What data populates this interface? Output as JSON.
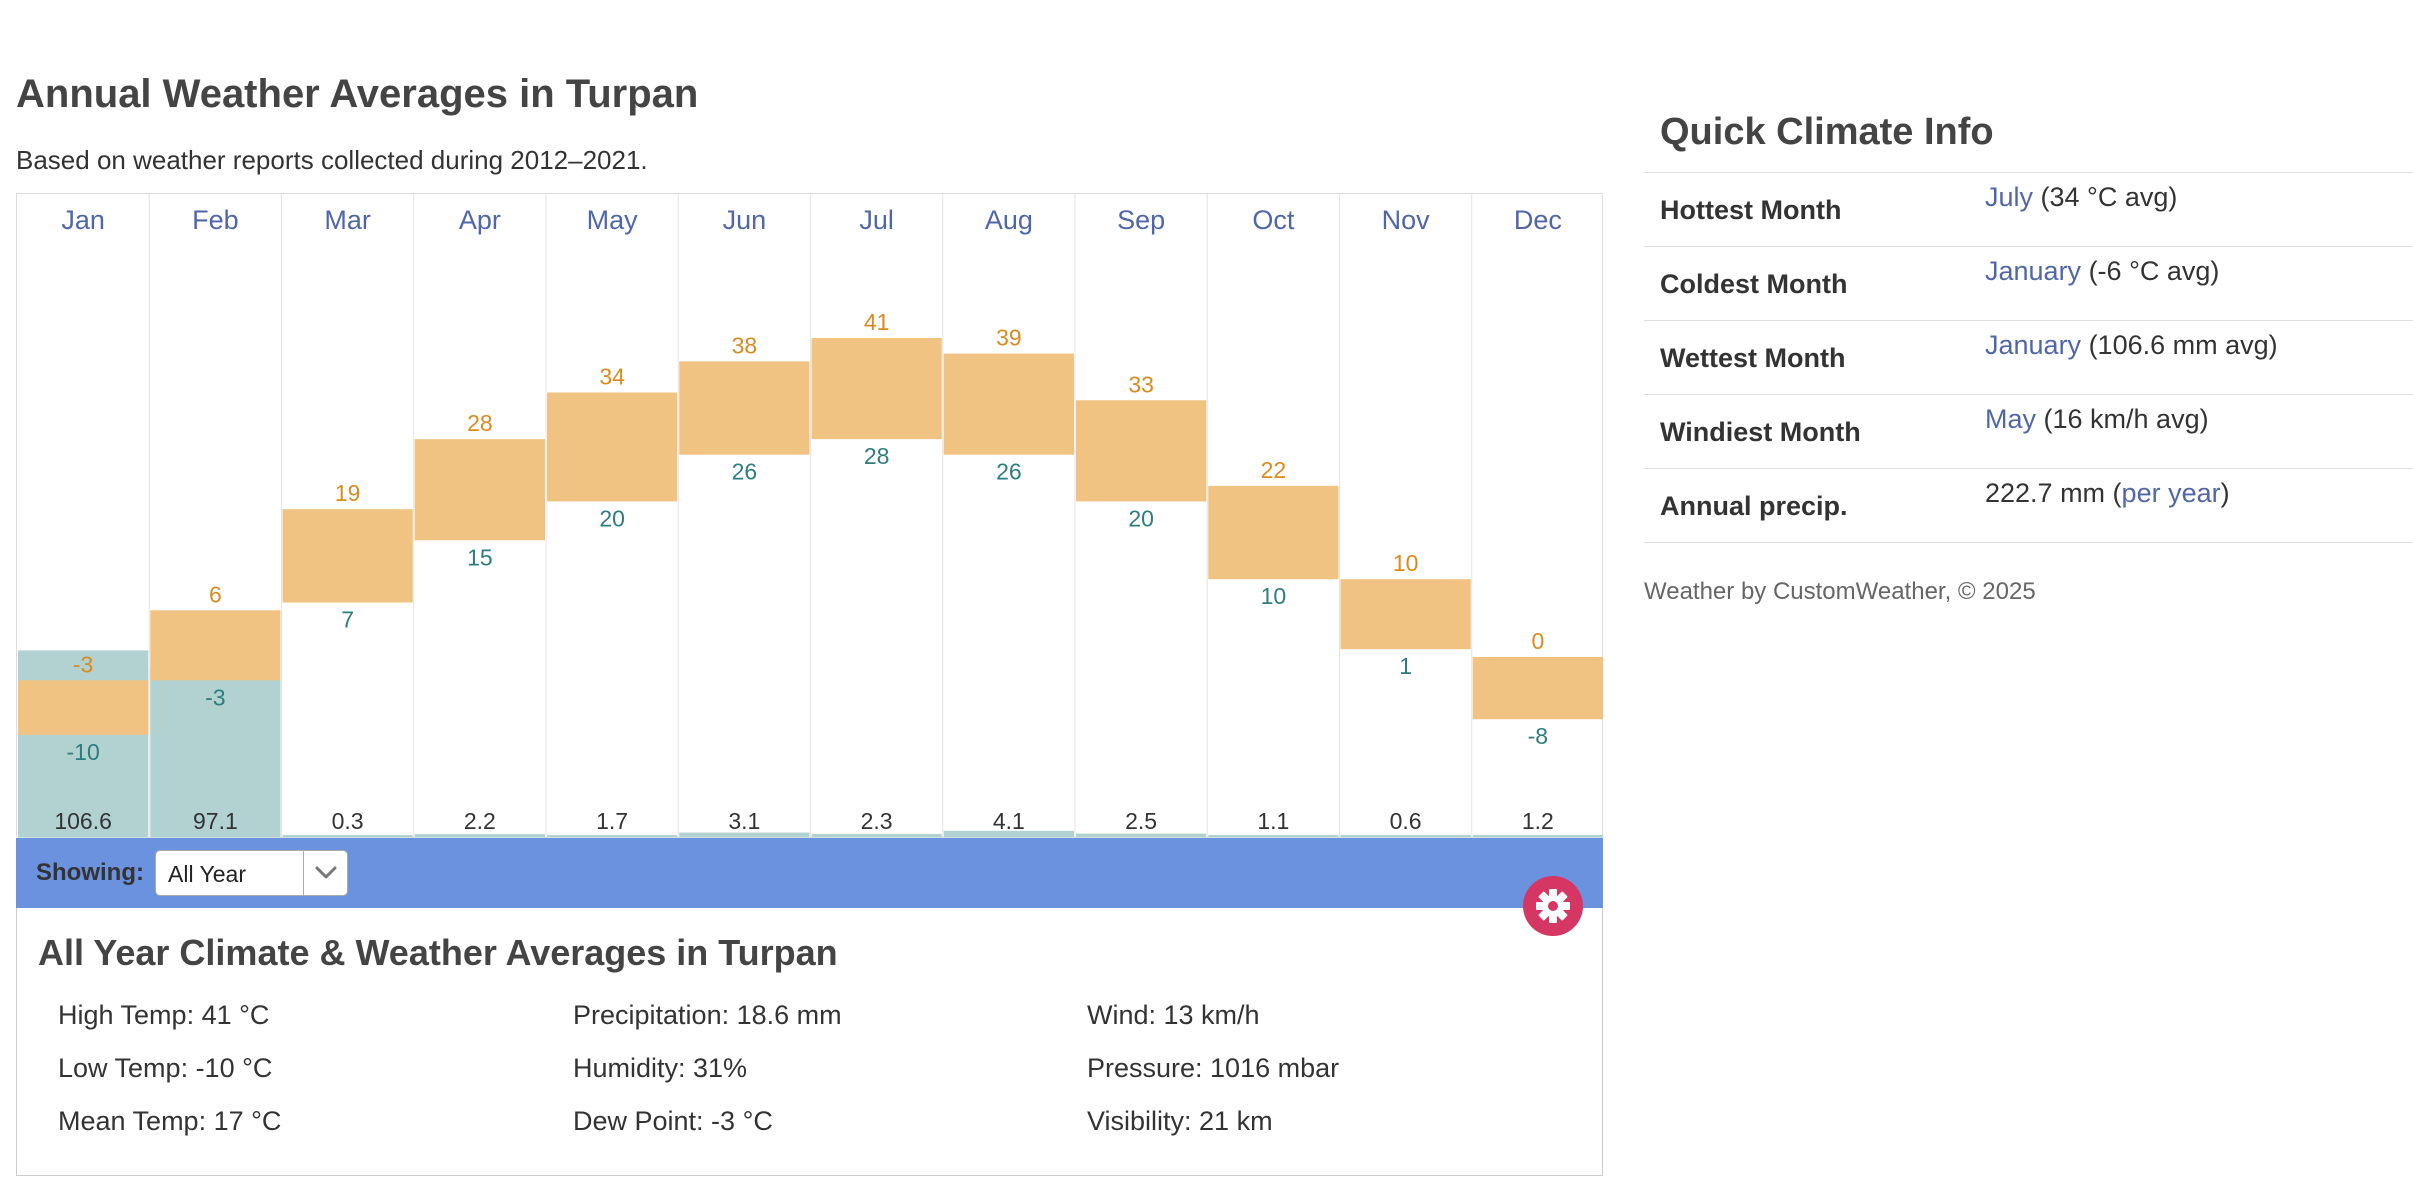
{
  "page": {
    "title": "Annual Weather Averages in Turpan",
    "subtitle": "Based on weather reports collected during 2012–2021."
  },
  "chart_data": {
    "type": "bar",
    "categories": [
      "Jan",
      "Feb",
      "Mar",
      "Apr",
      "May",
      "Jun",
      "Jul",
      "Aug",
      "Sep",
      "Oct",
      "Nov",
      "Dec"
    ],
    "series": [
      {
        "name": "",
        "values": [
          -3,
          6,
          19,
          28,
          34,
          38,
          41,
          39,
          33,
          22,
          10,
          0
        ]
      },
      {
        "name": "",
        "values": [
          -10,
          -3,
          7,
          15,
          20,
          26,
          28,
          26,
          20,
          10,
          1,
          -8
        ]
      },
      {
        "name": "",
        "values": [
          106.6,
          97.1,
          0.3,
          2.2,
          1.7,
          3.1,
          2.3,
          4.1,
          2.5,
          1.1,
          0.6,
          1.2
        ]
      }
    ],
    "title": "",
    "xlabel": "",
    "ylabel": "",
    "grid": true,
    "colors": {
      "temp_bar": "#f0c382",
      "high_label": "#d98b1e",
      "low_label": "#2e7d7d",
      "precip_bar": "#b2d1d1",
      "month_label": "#5166a8",
      "grid": "#e4e4e4"
    }
  },
  "controls": {
    "showing_label": "Showing:",
    "period_value": "All Year",
    "period_arrow_icon": "chevron-down-icon",
    "settings_icon": "gear-icon",
    "settings_color": "#d63664",
    "bar_color": "#6a92df"
  },
  "summary": {
    "title": "All Year Climate & Weather Averages in Turpan",
    "stats": [
      "High Temp: 41 °C",
      "Precipitation: 18.6 mm",
      "Wind: 13 km/h",
      "Low Temp: -10 °C",
      "Humidity: 31%",
      "Pressure: 1016 mbar",
      "Mean Temp: 17 °C",
      "Dew Point: -3 °C",
      "Visibility: 21 km"
    ]
  },
  "climate_info": {
    "title": "Quick Climate Info",
    "rows": [
      {
        "label": "Hottest Month",
        "link": "July",
        "rest": " (34 °C avg)"
      },
      {
        "label": "Coldest Month",
        "link": "January",
        "rest": " (-6 °C avg)"
      },
      {
        "label": "Wettest Month",
        "link": "January",
        "rest": " (106.6 mm avg)"
      },
      {
        "label": "Windiest Month",
        "link": "May",
        "rest": " (16 km/h avg)"
      }
    ],
    "precip": {
      "label": "Annual precip.",
      "pre": "222.7 mm (",
      "link": "per year",
      "post": ")"
    },
    "credit": "Weather by CustomWeather, © 2025"
  }
}
